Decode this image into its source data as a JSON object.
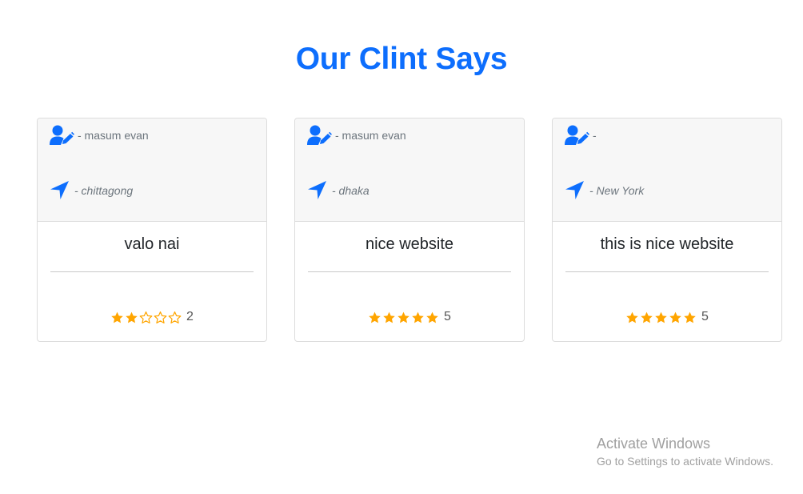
{
  "section": {
    "title": "Our Clint Says",
    "title_color": "#0d6efd"
  },
  "icons": {
    "user": "user-edit-icon",
    "location": "location-arrow-icon",
    "star_filled": "star-filled-icon",
    "star_empty": "star-outline-icon"
  },
  "colors": {
    "icon": "#0d6efd",
    "star": "#ffa500"
  },
  "reviews": [
    {
      "name_line": "- masum evan",
      "location_line": "- chittagong",
      "comment": "valo nai",
      "rating": 2,
      "rating_label": "2",
      "max_rating": 5
    },
    {
      "name_line": "- masum evan",
      "location_line": "- dhaka",
      "comment": "nice website",
      "rating": 5,
      "rating_label": "5",
      "max_rating": 5
    },
    {
      "name_line": "-",
      "location_line": "- New York",
      "comment": "this is nice website",
      "rating": 5,
      "rating_label": "5",
      "max_rating": 5
    }
  ],
  "watermark": {
    "title": "Activate Windows",
    "subtitle": "Go to Settings to activate Windows."
  }
}
